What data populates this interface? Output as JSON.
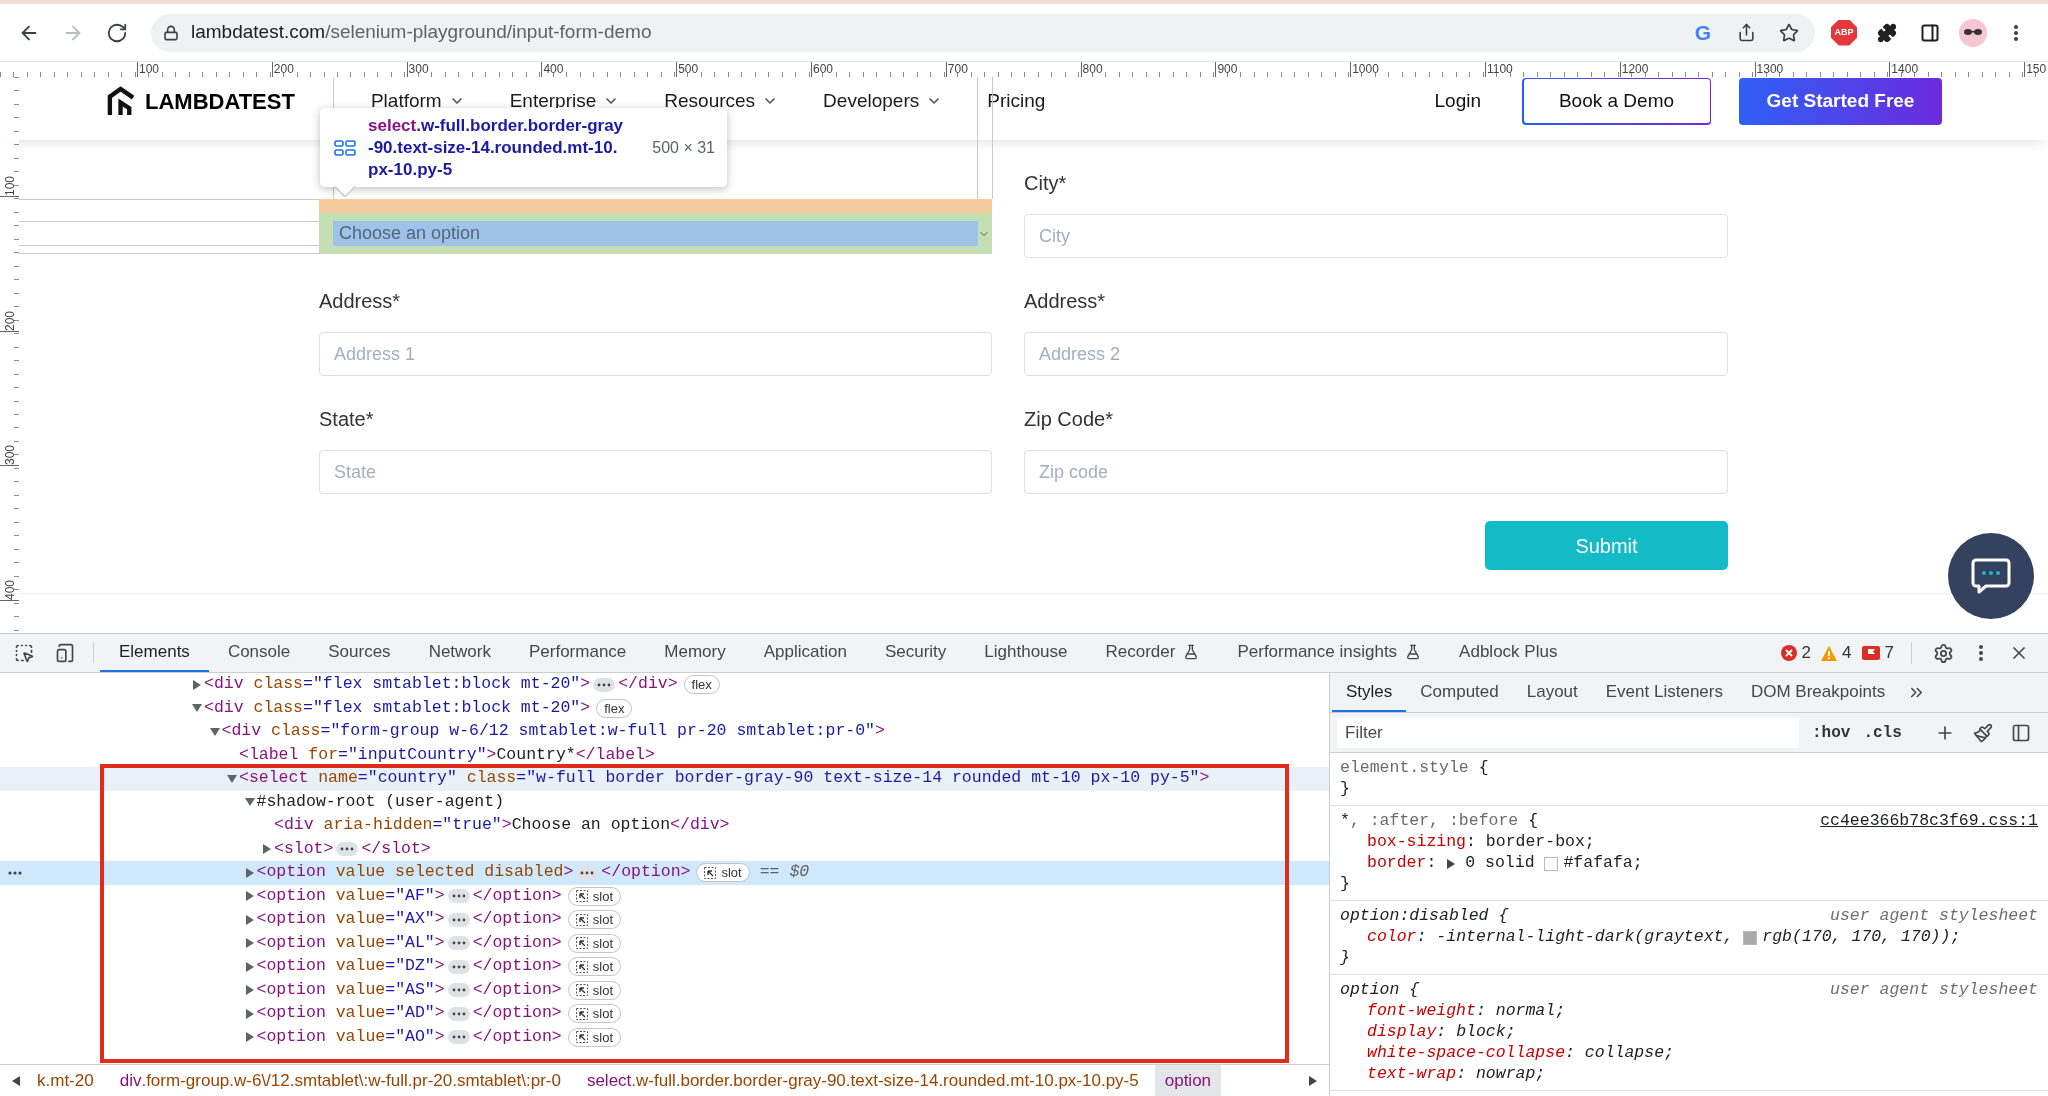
{
  "browser": {
    "nav_buttons": [
      {
        "kind": "back",
        "disabled": false
      },
      {
        "kind": "forward",
        "disabled": true
      },
      {
        "kind": "reload",
        "disabled": false
      }
    ],
    "url_host": "lambdatest.com",
    "url_path": "/selenium-playground/input-form-demo",
    "omnibox_mark": "G",
    "extension_badge": "ABP"
  },
  "rulers": {
    "horizontal": [
      "100",
      "200",
      "300",
      "400",
      "500",
      "600",
      "700",
      "800",
      "900",
      "1000",
      "1100",
      "1200",
      "1300",
      "1400",
      "150"
    ],
    "vertical": [
      "100",
      "200",
      "300",
      "400"
    ]
  },
  "site_header": {
    "logo": "LAMBDATEST",
    "menu": [
      {
        "label": "Platform",
        "dropdown": true
      },
      {
        "label": "Enterprise",
        "dropdown": true
      },
      {
        "label": "Resources",
        "dropdown": true
      },
      {
        "label": "Developers",
        "dropdown": true
      },
      {
        "label": "Pricing",
        "dropdown": false
      }
    ],
    "login": "Login",
    "demo_button": "Book a Demo",
    "cta_button": "Get Started Free"
  },
  "inspect_tooltip": {
    "tag": "select",
    "classes": ".w-full.border.border-gray-90.text-size-14.rounded.mt-10.px-10.py-5",
    "size": "500 × 31"
  },
  "form": {
    "fields": [
      {
        "kind": "select",
        "value": "Choose an option",
        "highlighted": true
      },
      {
        "kind": "input",
        "label": "City*",
        "placeholder": "City",
        "highlighted": false
      },
      {
        "kind": "input",
        "label": "Address*",
        "placeholder": "Address 1",
        "highlighted": false
      },
      {
        "kind": "input",
        "label": "Address*",
        "placeholder": "Address 2",
        "highlighted": false
      },
      {
        "kind": "input",
        "label": "State*",
        "placeholder": "State",
        "highlighted": false
      },
      {
        "kind": "input",
        "label": "Zip Code*",
        "placeholder": "Zip code",
        "highlighted": false
      }
    ],
    "submit": "Submit"
  },
  "devtools": {
    "tabs": [
      {
        "label": "Elements",
        "selected": true,
        "experimental": false
      },
      {
        "label": "Console",
        "selected": false,
        "experimental": false
      },
      {
        "label": "Sources",
        "selected": false,
        "experimental": false
      },
      {
        "label": "Network",
        "selected": false,
        "experimental": false
      },
      {
        "label": "Performance",
        "selected": false,
        "experimental": false
      },
      {
        "label": "Memory",
        "selected": false,
        "experimental": false
      },
      {
        "label": "Application",
        "selected": false,
        "experimental": false
      },
      {
        "label": "Security",
        "selected": false,
        "experimental": false
      },
      {
        "label": "Lighthouse",
        "selected": false,
        "experimental": false
      },
      {
        "label": "Recorder",
        "selected": false,
        "experimental": true
      },
      {
        "label": "Performance insights",
        "selected": false,
        "experimental": true
      },
      {
        "label": "Adblock Plus",
        "selected": false,
        "experimental": false
      }
    ],
    "counters": [
      {
        "kind": "error",
        "count": "2"
      },
      {
        "kind": "warning",
        "count": "4"
      },
      {
        "kind": "issue",
        "count": "7"
      }
    ],
    "dom_tree": [
      {
        "open": [
          {
            "kind": "tag",
            "text": "<div"
          },
          {
            "kind": "attr",
            "text": " class"
          },
          {
            "kind": "value",
            "text": "=\"flex smtablet:block mt-20\""
          },
          {
            "kind": "tag",
            "text": ">"
          }
        ],
        "expanded": false,
        "close": [
          {
            "kind": "tag",
            "text": "</div>"
          }
        ],
        "badge": {
          "kind": "flex",
          "label": "flex"
        },
        "selected": false,
        "hovered": false
      },
      {
        "open": [
          {
            "kind": "tag",
            "text": "<div"
          },
          {
            "kind": "attr",
            "text": " class"
          },
          {
            "kind": "value",
            "text": "=\"flex smtablet:block mt-20\""
          },
          {
            "kind": "tag",
            "text": ">"
          }
        ],
        "expanded": true,
        "badge": {
          "kind": "flex",
          "label": "flex"
        },
        "selected": false,
        "hovered": false,
        "children": [
          {
            "open": [
              {
                "kind": "tag",
                "text": "<div"
              },
              {
                "kind": "attr",
                "text": " class"
              },
              {
                "kind": "value",
                "text": "=\"form-group w-6/12 smtablet:w-full pr-20 smtablet:pr-0\""
              },
              {
                "kind": "tag",
                "text": ">"
              }
            ],
            "expanded": true,
            "selected": false,
            "hovered": false,
            "children": [
              {
                "open": [
                  {
                    "kind": "tag",
                    "text": "<label"
                  },
                  {
                    "kind": "attr",
                    "text": " for"
                  },
                  {
                    "kind": "value",
                    "text": "=\"inputCountry\""
                  },
                  {
                    "kind": "tag",
                    "text": ">"
                  },
                  {
                    "kind": "text",
                    "text": "Country*"
                  },
                  {
                    "kind": "tag",
                    "text": "</label>"
                  }
                ],
                "selected": false,
                "hovered": false
              },
              {
                "open": [
                  {
                    "kind": "tag",
                    "text": "<select"
                  },
                  {
                    "kind": "attr",
                    "text": " name"
                  },
                  {
                    "kind": "value",
                    "text": "=\"country\""
                  },
                  {
                    "kind": "attr",
                    "text": " class"
                  },
                  {
                    "kind": "value",
                    "text": "=\"w-full border border-gray-90 text-size-14 rounded mt-10 px-10 py-5\""
                  },
                  {
                    "kind": "tag",
                    "text": ">"
                  }
                ],
                "expanded": true,
                "selected": false,
                "hovered": true,
                "children": [
                  {
                    "open": [
                      {
                        "kind": "text",
                        "text": "#shadow-root (user-agent)"
                      }
                    ],
                    "expanded": true,
                    "selected": false,
                    "hovered": false,
                    "children": [
                      {
                        "open": [
                          {
                            "kind": "tag",
                            "text": "<div"
                          },
                          {
                            "kind": "attr",
                            "text": " aria-hidden"
                          },
                          {
                            "kind": "value",
                            "text": "=\"true\""
                          },
                          {
                            "kind": "tag",
                            "text": ">"
                          },
                          {
                            "kind": "text",
                            "text": "Choose an option"
                          },
                          {
                            "kind": "tag",
                            "text": "</div>"
                          }
                        ],
                        "selected": false,
                        "hovered": false
                      },
                      {
                        "open": [
                          {
                            "kind": "tag",
                            "text": "<slot>"
                          }
                        ],
                        "expanded": false,
                        "close": [
                          {
                            "kind": "tag",
                            "text": "</slot>"
                          }
                        ],
                        "selected": false,
                        "hovered": false
                      }
                    ]
                  },
                  {
                    "open": [
                      {
                        "kind": "tag",
                        "text": "<option"
                      },
                      {
                        "kind": "attr",
                        "text": " value selected disabled"
                      },
                      {
                        "kind": "tag",
                        "text": ">"
                      }
                    ],
                    "expanded": false,
                    "close": [
                      {
                        "kind": "tag",
                        "text": "</option>"
                      }
                    ],
                    "badge": {
                      "kind": "slot",
                      "label": "slot"
                    },
                    "selected": true,
                    "hovered": false,
                    "console_ref": "== $0"
                  },
                  {
                    "open": [
                      {
                        "kind": "tag",
                        "text": "<option"
                      },
                      {
                        "kind": "attr",
                        "text": " value"
                      },
                      {
                        "kind": "value",
                        "text": "=\"AF\""
                      },
                      {
                        "kind": "tag",
                        "text": ">"
                      }
                    ],
                    "expanded": false,
                    "close": [
                      {
                        "kind": "tag",
                        "text": "</option>"
                      }
                    ],
                    "badge": {
                      "kind": "slot",
                      "label": "slot"
                    },
                    "selected": false,
                    "hovered": false
                  },
                  {
                    "open": [
                      {
                        "kind": "tag",
                        "text": "<option"
                      },
                      {
                        "kind": "attr",
                        "text": " value"
                      },
                      {
                        "kind": "value",
                        "text": "=\"AX\""
                      },
                      {
                        "kind": "tag",
                        "text": ">"
                      }
                    ],
                    "expanded": false,
                    "close": [
                      {
                        "kind": "tag",
                        "text": "</option>"
                      }
                    ],
                    "badge": {
                      "kind": "slot",
                      "label": "slot"
                    },
                    "selected": false,
                    "hovered": false
                  },
                  {
                    "open": [
                      {
                        "kind": "tag",
                        "text": "<option"
                      },
                      {
                        "kind": "attr",
                        "text": " value"
                      },
                      {
                        "kind": "value",
                        "text": "=\"AL\""
                      },
                      {
                        "kind": "tag",
                        "text": ">"
                      }
                    ],
                    "expanded": false,
                    "close": [
                      {
                        "kind": "tag",
                        "text": "</option>"
                      }
                    ],
                    "badge": {
                      "kind": "slot",
                      "label": "slot"
                    },
                    "selected": false,
                    "hovered": false
                  },
                  {
                    "open": [
                      {
                        "kind": "tag",
                        "text": "<option"
                      },
                      {
                        "kind": "attr",
                        "text": " value"
                      },
                      {
                        "kind": "value",
                        "text": "=\"DZ\""
                      },
                      {
                        "kind": "tag",
                        "text": ">"
                      }
                    ],
                    "expanded": false,
                    "close": [
                      {
                        "kind": "tag",
                        "text": "</option>"
                      }
                    ],
                    "badge": {
                      "kind": "slot",
                      "label": "slot"
                    },
                    "selected": false,
                    "hovered": false
                  },
                  {
                    "open": [
                      {
                        "kind": "tag",
                        "text": "<option"
                      },
                      {
                        "kind": "attr",
                        "text": " value"
                      },
                      {
                        "kind": "value",
                        "text": "=\"AS\""
                      },
                      {
                        "kind": "tag",
                        "text": ">"
                      }
                    ],
                    "expanded": false,
                    "close": [
                      {
                        "kind": "tag",
                        "text": "</option>"
                      }
                    ],
                    "badge": {
                      "kind": "slot",
                      "label": "slot"
                    },
                    "selected": false,
                    "hovered": false
                  },
                  {
                    "open": [
                      {
                        "kind": "tag",
                        "text": "<option"
                      },
                      {
                        "kind": "attr",
                        "text": " value"
                      },
                      {
                        "kind": "value",
                        "text": "=\"AD\""
                      },
                      {
                        "kind": "tag",
                        "text": ">"
                      }
                    ],
                    "expanded": false,
                    "close": [
                      {
                        "kind": "tag",
                        "text": "</option>"
                      }
                    ],
                    "badge": {
                      "kind": "slot",
                      "label": "slot"
                    },
                    "selected": false,
                    "hovered": false
                  },
                  {
                    "open": [
                      {
                        "kind": "tag",
                        "text": "<option"
                      },
                      {
                        "kind": "attr",
                        "text": " value"
                      },
                      {
                        "kind": "value",
                        "text": "=\"AO\""
                      },
                      {
                        "kind": "tag",
                        "text": ">"
                      }
                    ],
                    "expanded": false,
                    "close": [
                      {
                        "kind": "tag",
                        "text": "</option>"
                      }
                    ],
                    "badge": {
                      "kind": "slot",
                      "label": "slot"
                    },
                    "selected": false,
                    "hovered": false
                  }
                ]
              }
            ]
          }
        ]
      }
    ],
    "breadcrumbs": [
      {
        "classes": "k.mt-20",
        "selected": false
      },
      {
        "tag": "div",
        "classes": ".form-group.w-6\\/12.smtablet\\:w-full.pr-20.smtablet\\:pr-0",
        "selected": false
      },
      {
        "tag": "select",
        "classes": ".w-full.border.border-gray-90.text-size-14.rounded.mt-10.px-10.py-5",
        "selected": false
      },
      {
        "tag": "option",
        "selected": true
      }
    ],
    "styles_pane": {
      "tabs": [
        {
          "label": "Styles",
          "selected": true
        },
        {
          "label": "Computed",
          "selected": false
        },
        {
          "label": "Layout",
          "selected": false
        },
        {
          "label": "Event Listeners",
          "selected": false
        },
        {
          "label": "DOM Breakpoints",
          "selected": false
        }
      ],
      "filter_placeholder": "Filter",
      "state_toggle": ":hov",
      "class_toggle": ".cls",
      "rules": [
        {
          "kind": "inline",
          "selector": [
            {
              "kind": "dim",
              "text": "element.style"
            },
            {
              "kind": "plain",
              "text": " {"
            }
          ],
          "closing": "}"
        },
        {
          "kind": "author",
          "selector": [
            {
              "kind": "plain",
              "text": "*"
            },
            {
              "kind": "dim",
              "text": ", :after, :before"
            },
            {
              "kind": "plain",
              "text": " {"
            }
          ],
          "source": "cc4ee366b78c3f69.css:1",
          "declarations": [
            {
              "property": "box-sizing",
              "separator": ": ",
              "value": [
                {
                  "kind": "text",
                  "text": "border-box;"
                }
              ]
            },
            {
              "property": "border",
              "separator": ": ",
              "value": [
                {
                  "kind": "toggle",
                  "expanded": false
                },
                {
                  "kind": "text",
                  "text": "0 solid "
                },
                {
                  "kind": "swatch",
                  "color": "#fafafa"
                },
                {
                  "kind": "text",
                  "text": "#fafafa;"
                }
              ]
            }
          ],
          "closing": "}"
        },
        {
          "kind": "builtin",
          "selector": [
            {
              "kind": "plain",
              "text": "option:disabled {"
            }
          ],
          "source": "user agent stylesheet",
          "declarations": [
            {
              "property": "color",
              "separator": ": ",
              "value": [
                {
                  "kind": "text",
                  "text": "-internal-light-dark(graytext, "
                },
                {
                  "kind": "swatch",
                  "color": "#aaaaaa"
                },
                {
                  "kind": "text",
                  "text": "rgb(170, 170, 170));"
                }
              ]
            }
          ],
          "closing": "}"
        },
        {
          "kind": "builtin",
          "selector": [
            {
              "kind": "plain",
              "text": "option {"
            }
          ],
          "source": "user agent stylesheet",
          "declarations": [
            {
              "property": "font-weight",
              "separator": ": ",
              "value": [
                {
                  "kind": "text",
                  "text": "normal;"
                }
              ]
            },
            {
              "property": "display",
              "separator": ": ",
              "value": [
                {
                  "kind": "text",
                  "text": "block;"
                }
              ]
            },
            {
              "property": "white-space-collapse",
              "separator": ": ",
              "value": [
                {
                  "kind": "text",
                  "text": "collapse;"
                }
              ]
            },
            {
              "property": "text-wrap",
              "separator": ": ",
              "value": [
                {
                  "kind": "text",
                  "text": "nowrap;"
                }
              ]
            }
          ]
        }
      ]
    }
  }
}
